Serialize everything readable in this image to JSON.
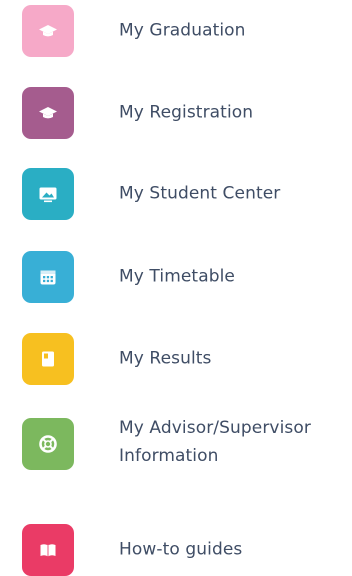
{
  "menu": {
    "items": [
      {
        "label": "My Graduation",
        "icon": "graduation-cap-icon",
        "color": "#f6a9c8"
      },
      {
        "label": "My Registration",
        "icon": "graduation-cap-icon",
        "color": "#a55c8e"
      },
      {
        "label": "My Student Center",
        "icon": "image-frame-icon",
        "color": "#2aaec4"
      },
      {
        "label": "My Timetable",
        "icon": "calendar-icon",
        "color": "#38afd6"
      },
      {
        "label": "My Results",
        "icon": "document-icon",
        "color": "#f7c020"
      },
      {
        "label": "My Advisor/Supervisor Information",
        "icon": "lifebuoy-icon",
        "color": "#7cb85e"
      },
      {
        "label": "How-to guides",
        "icon": "book-icon",
        "color": "#ea3b66"
      }
    ]
  }
}
